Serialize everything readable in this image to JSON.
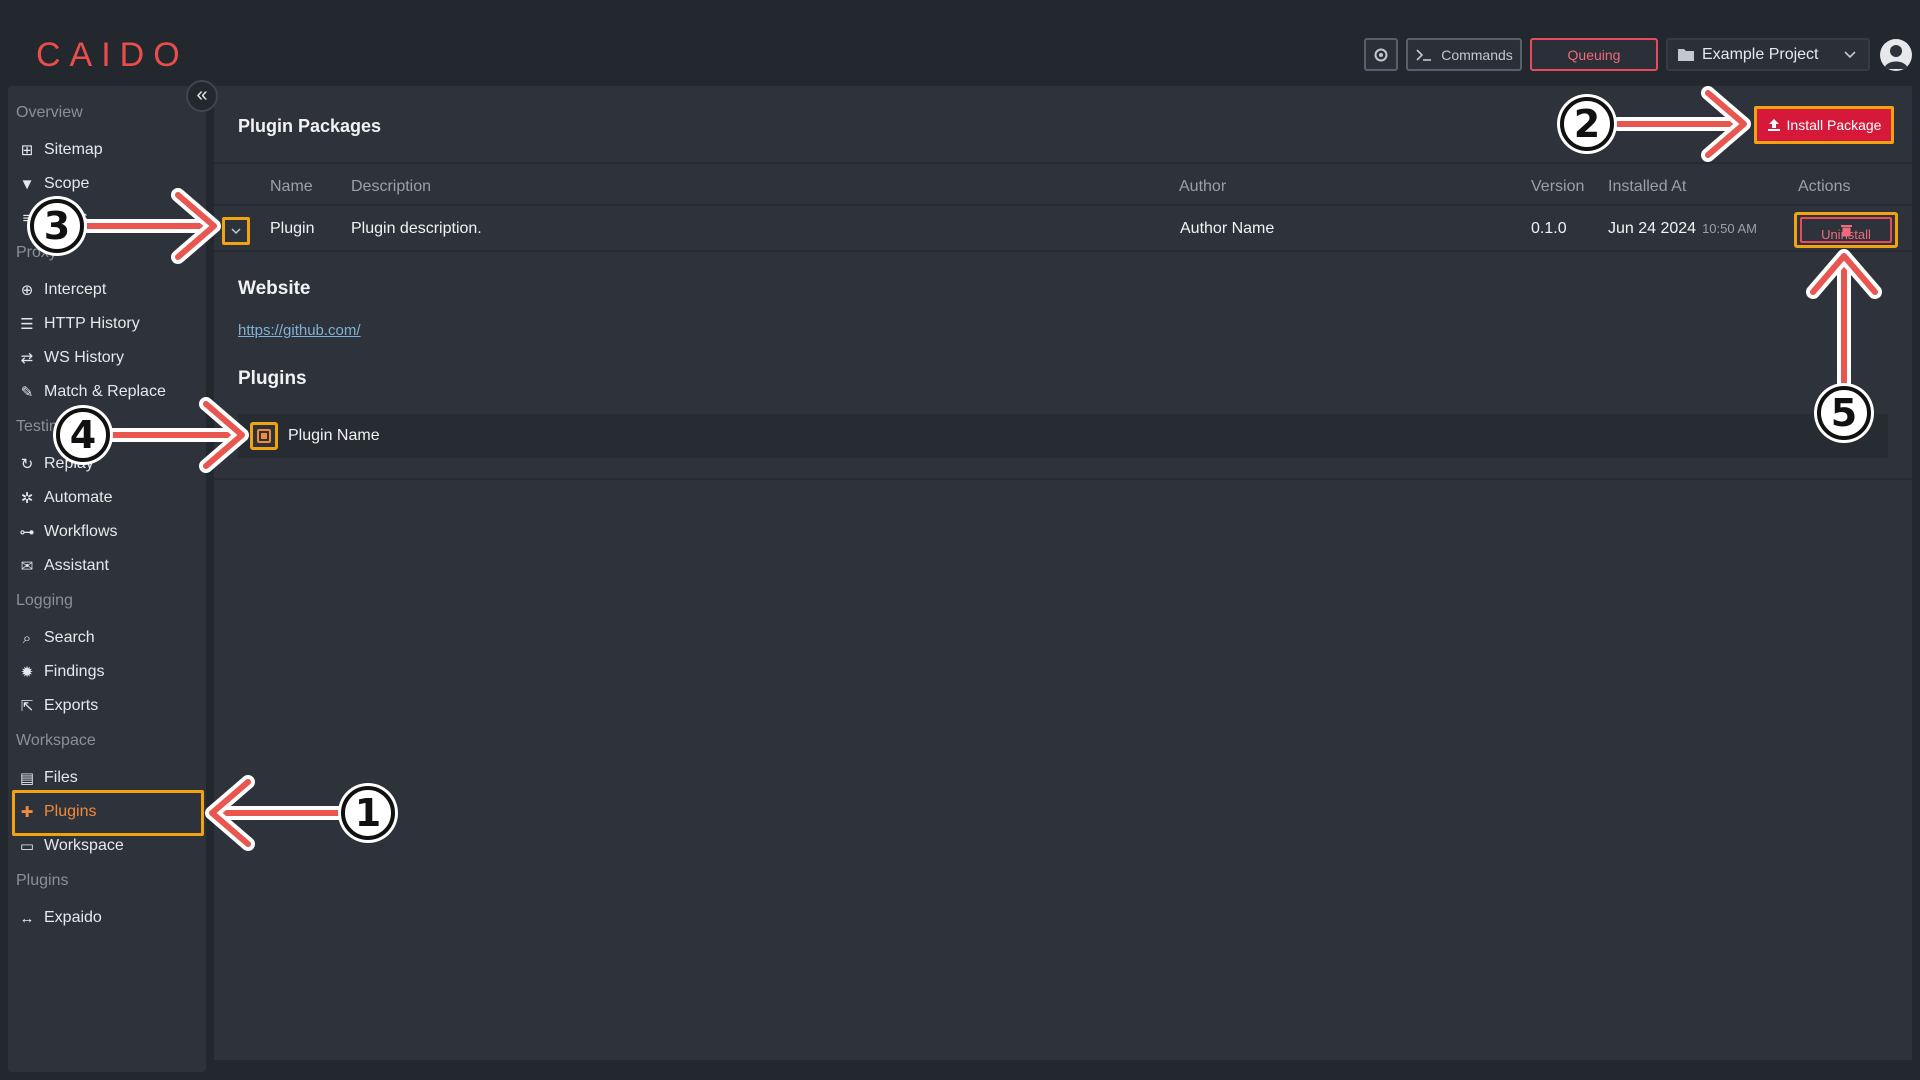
{
  "app": {
    "logo": "CAIDO",
    "accent_color": "#ea4e4b",
    "highlight_color": "#f2a312"
  },
  "topbar": {
    "settings_icon": "gear-icon",
    "commands_label": "Commands",
    "queuing_label": "Queuing",
    "project_label": "Example Project",
    "avatar_icon": "user-icon"
  },
  "sidebar": {
    "sections": [
      {
        "label": "Overview",
        "items": [
          {
            "label": "Sitemap",
            "icon": "sitemap-icon"
          },
          {
            "label": "Scope",
            "icon": "filter-icon"
          },
          {
            "label": "Filters",
            "icon": "filters-icon"
          }
        ]
      },
      {
        "label": "Proxy",
        "items": [
          {
            "label": "Intercept",
            "icon": "crosshair-icon"
          },
          {
            "label": "HTTP History",
            "icon": "list-icon"
          },
          {
            "label": "WS History",
            "icon": "arrows-exchange-icon"
          },
          {
            "label": "Match & Replace",
            "icon": "wrench-icon"
          }
        ]
      },
      {
        "label": "Testing",
        "items": [
          {
            "label": "Replay",
            "icon": "refresh-icon"
          },
          {
            "label": "Automate",
            "icon": "gear-icon"
          },
          {
            "label": "Workflows",
            "icon": "workflow-icon"
          },
          {
            "label": "Assistant",
            "icon": "chat-icon"
          }
        ]
      },
      {
        "label": "Logging",
        "items": [
          {
            "label": "Search",
            "icon": "search-icon"
          },
          {
            "label": "Findings",
            "icon": "bug-icon"
          },
          {
            "label": "Exports",
            "icon": "file-export-icon"
          }
        ]
      },
      {
        "label": "Workspace",
        "items": [
          {
            "label": "Files",
            "icon": "file-icon"
          },
          {
            "label": "Plugins",
            "icon": "puzzle-icon",
            "active": true
          },
          {
            "label": "Workspace",
            "icon": "monitor-icon"
          }
        ]
      },
      {
        "label": "Plugins",
        "items": [
          {
            "label": "Expaido",
            "icon": "arrows-horizontal-icon"
          }
        ]
      }
    ]
  },
  "main": {
    "title": "Plugin Packages",
    "install_label": "Install Package",
    "columns": [
      "Name",
      "Description",
      "Author",
      "Version",
      "Installed At",
      "Actions"
    ],
    "rows": [
      {
        "name": "Plugin",
        "description": "Plugin description.",
        "author": "Author Name",
        "version": "0.1.0",
        "installed_date": "Jun 24 2024",
        "installed_time": "10:50 AM",
        "action_label": "Uninstall"
      }
    ],
    "details": {
      "website_heading": "Website",
      "website_url": "https://github.com/",
      "plugins_heading": "Plugins",
      "plugins": [
        "Plugin Name"
      ]
    }
  },
  "annotations": {
    "markers": [
      "1",
      "2",
      "3",
      "4",
      "5"
    ],
    "arrow_color": "#e8564f"
  }
}
